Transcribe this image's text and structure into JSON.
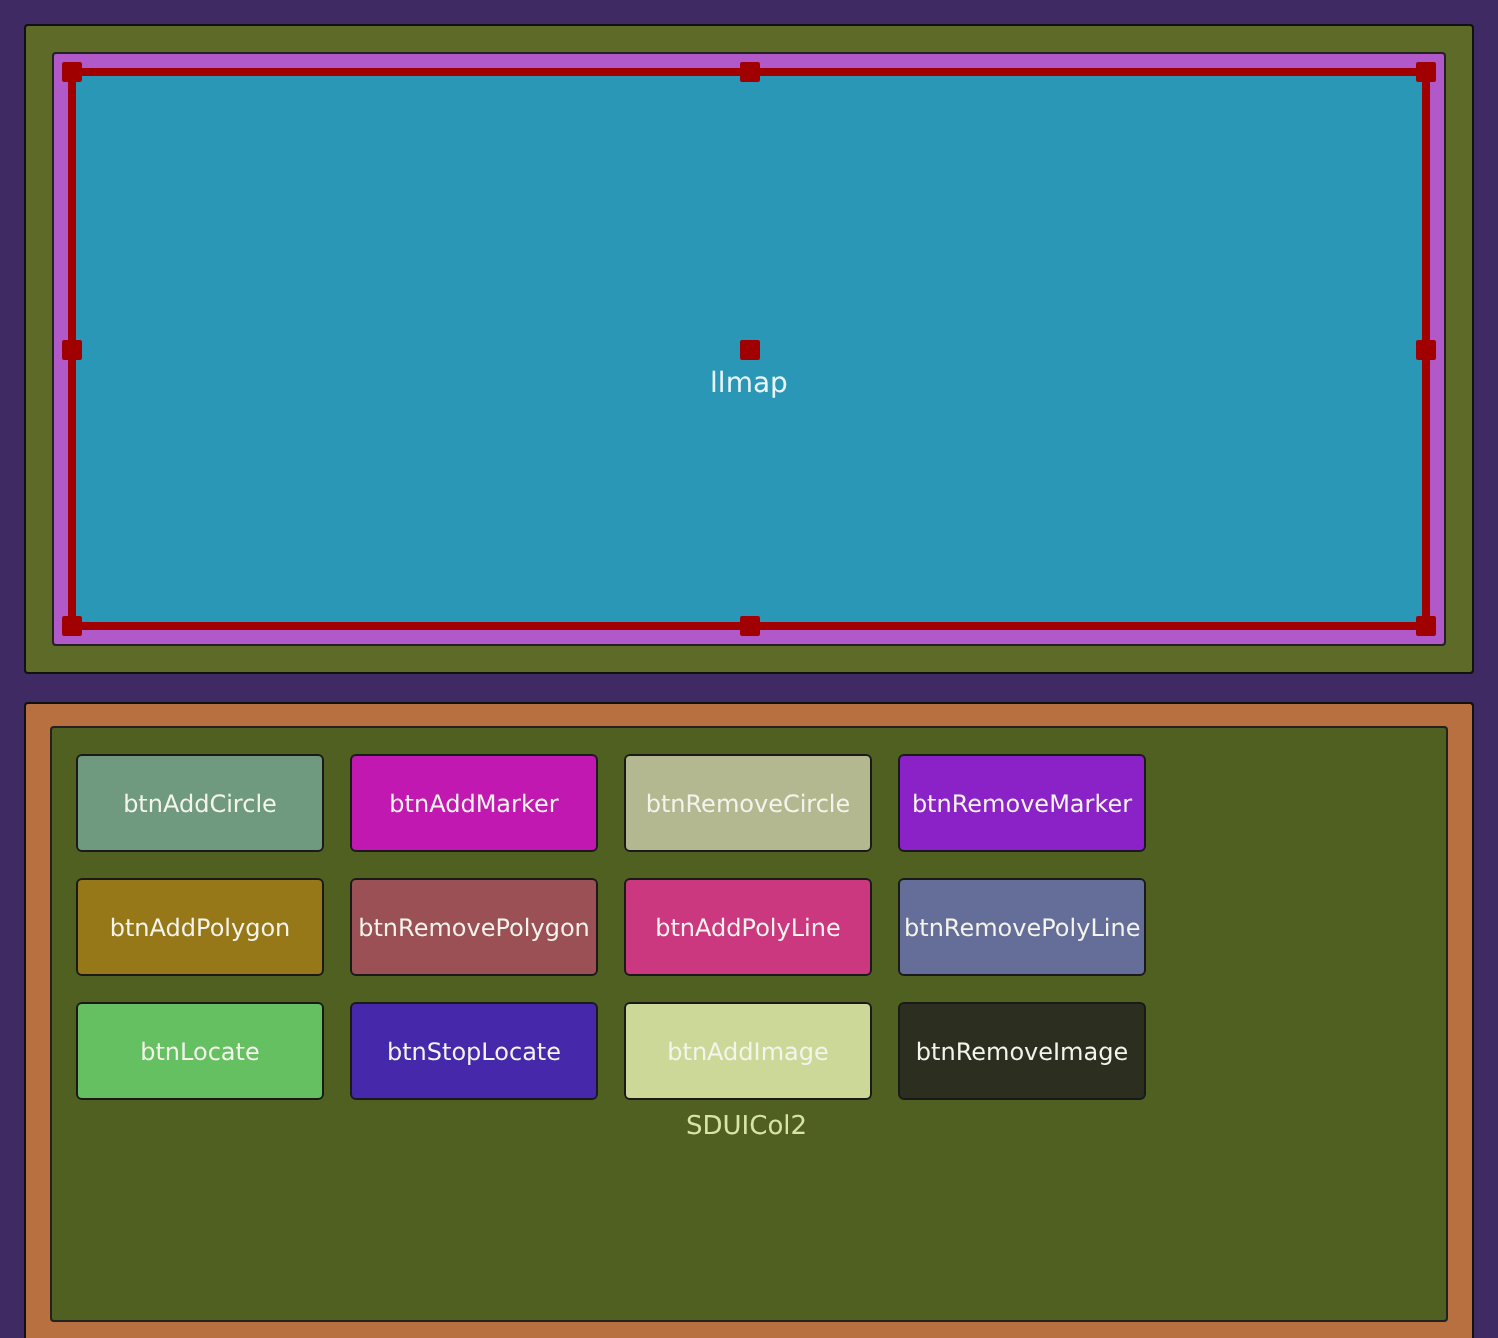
{
  "map_panel": {
    "label": "llmap",
    "selected": true
  },
  "button_panel": {
    "label": "SDUICol2",
    "buttons": [
      {
        "label": "btnAddCircle",
        "color": "#6f9a80"
      },
      {
        "label": "btnAddMarker",
        "color": "#c018b0"
      },
      {
        "label": "btnRemoveCircle",
        "color": "#b4b890"
      },
      {
        "label": "btnRemoveMarker",
        "color": "#8a22c8"
      },
      {
        "label": "btnAddPolygon",
        "color": "#967818"
      },
      {
        "label": "btnRemovePolygon",
        "color": "#9a5055"
      },
      {
        "label": "btnAddPolyLine",
        "color": "#cc3880"
      },
      {
        "label": "btnRemovePolyLine",
        "color": "#656e98"
      },
      {
        "label": "btnLocate",
        "color": "#64c060"
      },
      {
        "label": "btnStopLocate",
        "color": "#4628aa"
      },
      {
        "label": "btnAddImage",
        "color": "#ccd898"
      },
      {
        "label": "btnRemoveImage",
        "color": "#2c2e20"
      }
    ]
  }
}
